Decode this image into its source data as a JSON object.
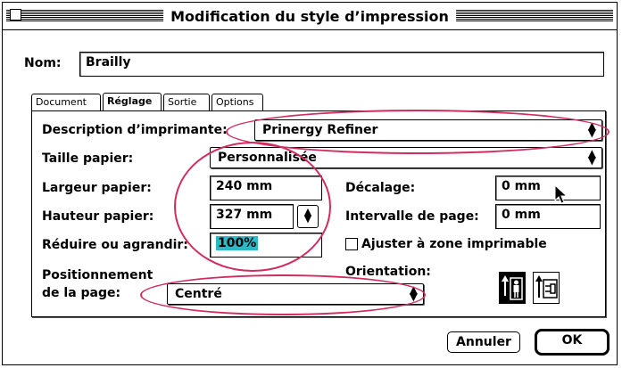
{
  "window": {
    "title": "Modification du style d’impression"
  },
  "name_field": {
    "label": "Nom:",
    "value": "Brailly"
  },
  "tabs": [
    {
      "label": "Document",
      "active": false
    },
    {
      "label": "Réglage",
      "active": true
    },
    {
      "label": "Sortie",
      "active": false
    },
    {
      "label": "Options",
      "active": false
    }
  ],
  "printer": {
    "label": "Description d’imprimante:",
    "value": "Prinergy Refiner"
  },
  "paper_size": {
    "label": "Taille papier:",
    "value": "Personnalisée"
  },
  "paper_width": {
    "label": "Largeur papier:",
    "value": "240 mm"
  },
  "paper_height": {
    "label": "Hauteur papier:",
    "value": "327 mm"
  },
  "scale": {
    "label": "Réduire ou agrandir:",
    "value": "100%"
  },
  "offset": {
    "label": "Décalage:",
    "value": "0 mm"
  },
  "page_gap": {
    "label": "Intervalle de page:",
    "value": "0 mm"
  },
  "fit_printable": {
    "label": "Ajuster à zone imprimable",
    "checked": false
  },
  "page_position": {
    "label_line1": "Positionnement",
    "label_line2": "de la page:",
    "value": "Centré"
  },
  "orientation": {
    "label": "Orientation:",
    "selected": "portrait"
  },
  "buttons": {
    "cancel": "Annuler",
    "ok": "OK"
  },
  "colors": {
    "highlight": "#2bb8c7",
    "annotation": "#d12c60"
  }
}
